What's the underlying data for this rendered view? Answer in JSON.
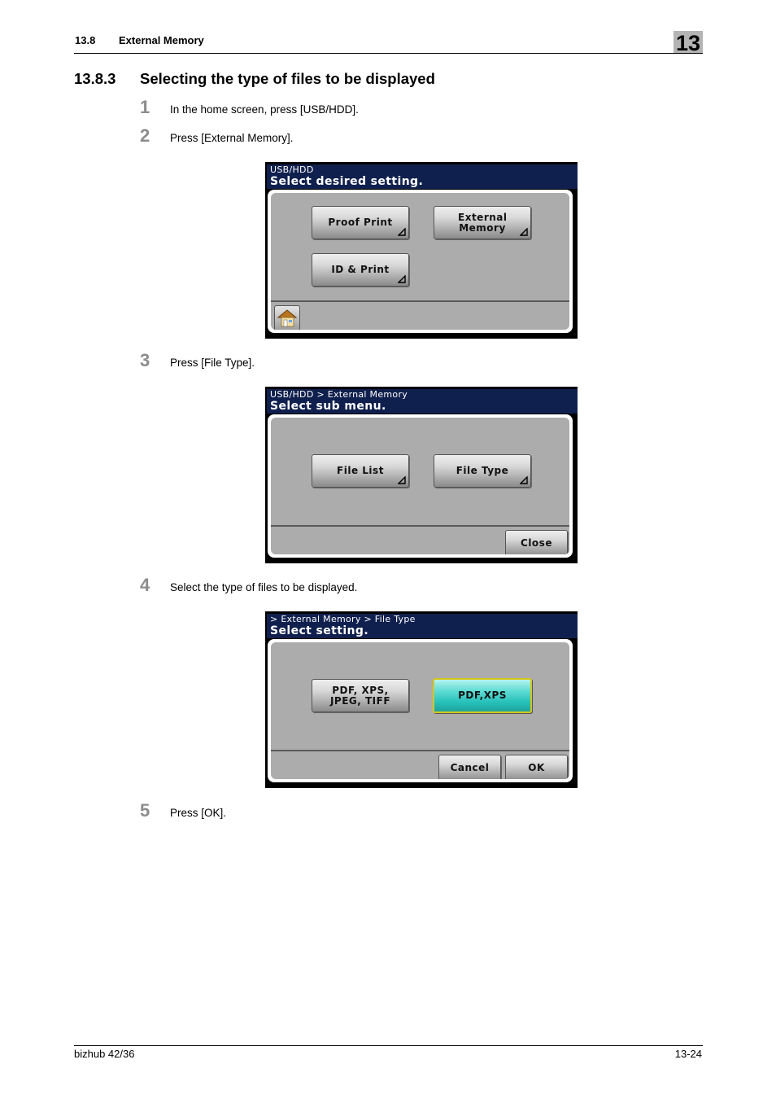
{
  "header": {
    "section_number": "13.8",
    "section_title": "External Memory",
    "chapter_number": "13"
  },
  "section": {
    "number": "13.8.3",
    "title": "Selecting the type of files to be displayed"
  },
  "steps": [
    {
      "number": "1",
      "text": "In the home screen, press [USB/HDD]."
    },
    {
      "number": "2",
      "text": "Press [External Memory]."
    },
    {
      "number": "3",
      "text": "Press [File Type]."
    },
    {
      "number": "4",
      "text": "Select the type of files to be displayed."
    },
    {
      "number": "5",
      "text": "Press [OK]."
    }
  ],
  "screens": [
    {
      "breadcrumb": "USB/HDD",
      "prompt": "Select desired setting.",
      "buttons": [
        "Proof Print",
        "External Memory",
        "ID & Print"
      ],
      "footer": {
        "home_icon": "home-icon"
      }
    },
    {
      "breadcrumb": "USB/HDD > External Memory",
      "prompt": "Select sub menu.",
      "buttons": [
        "File List",
        "File Type"
      ],
      "footer": {
        "close": "Close"
      }
    },
    {
      "breadcrumb": "> External Memory > File Type",
      "prompt": "Select setting.",
      "options": [
        {
          "label": "PDF, XPS, JPEG, TIFF",
          "selected": false
        },
        {
          "label": "PDF,XPS",
          "selected": true
        }
      ],
      "footer": {
        "cancel": "Cancel",
        "ok": "OK"
      }
    }
  ],
  "colors": {
    "title_bar": "#10204e",
    "panel_bg": "#acacac",
    "selected_button": "#27c1ba",
    "selected_border": "#d4c81a"
  },
  "footer": {
    "product": "bizhub 42/36",
    "page": "13-24"
  }
}
